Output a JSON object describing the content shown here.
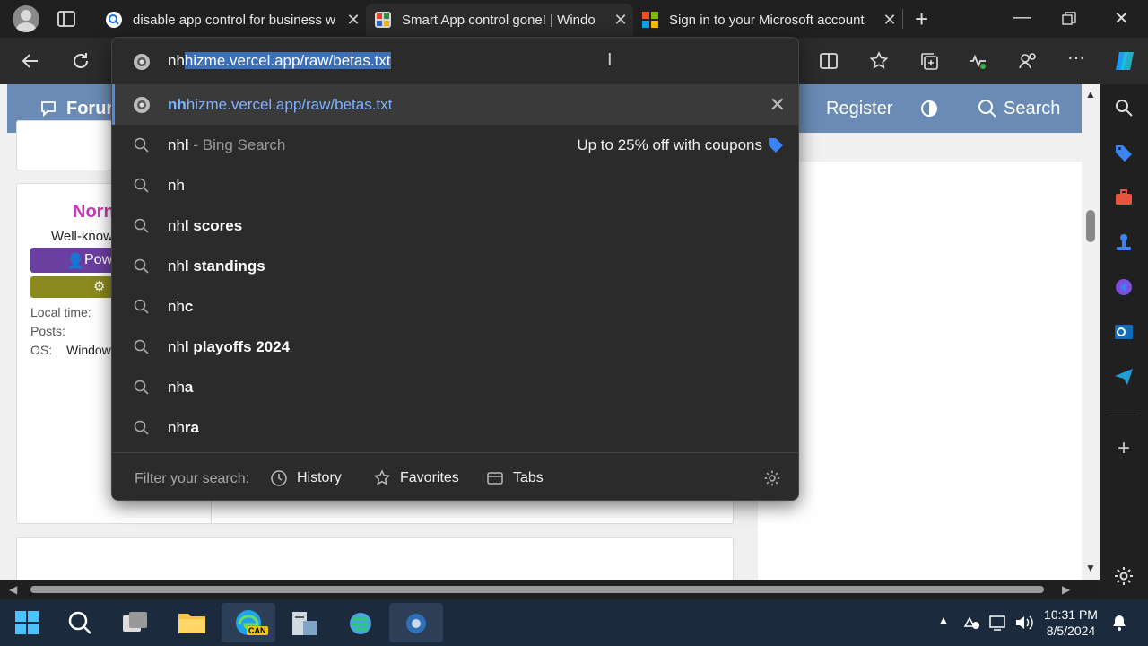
{
  "tabs": [
    {
      "title": "disable app control for business w",
      "active": false
    },
    {
      "title": "Smart App control gone! | Windo",
      "active": true
    },
    {
      "title": "Sign in to your Microsoft account",
      "active": false
    }
  ],
  "webpage": {
    "nav": {
      "forums": "Forur",
      "register": "Register",
      "search": "Search"
    },
    "profile": {
      "name": "Norn",
      "title": "Well-know",
      "badge": "Pow",
      "local_time_label": "Local time:",
      "posts_label": "Posts:",
      "os_label": "OS:",
      "os_value": "Window"
    }
  },
  "omnibox": {
    "typed": "nh",
    "autocomplete": "hizme.vercel.app/raw/betas.txt",
    "suggestions": [
      {
        "prefix": "nh",
        "rest": "hizme.vercel.app/raw/betas.txt",
        "kind": "url"
      },
      {
        "prefix": "nh",
        "rest": "l",
        "suffix": " - Bing Search",
        "promo": "Up to 25% off with coupons",
        "kind": "search"
      },
      {
        "prefix": "nh",
        "rest": "",
        "kind": "search"
      },
      {
        "prefix": "nh",
        "rest": "l scores",
        "kind": "search"
      },
      {
        "prefix": "nh",
        "rest": "l standings",
        "kind": "search"
      },
      {
        "prefix": "nh",
        "rest": "c",
        "kind": "search"
      },
      {
        "prefix": "nh",
        "rest": "l playoffs 2024",
        "kind": "search"
      },
      {
        "prefix": "nh",
        "rest": "a",
        "kind": "search"
      },
      {
        "prefix": "nh",
        "rest": "ra",
        "kind": "search"
      }
    ],
    "filter_label": "Filter your search:",
    "filters": {
      "history": "History",
      "favorites": "Favorites",
      "tabs": "Tabs"
    }
  },
  "taskbar": {
    "time": "10:31 PM",
    "date": "8/5/2024",
    "edge_badge": "CAN"
  },
  "colors": {
    "accent": "#3b6fb6",
    "forum_nav": "#6a8bb5",
    "profile_name": "#c23bb4",
    "badge_purple": "#6b3fa0",
    "badge_olive": "#8a8a1e"
  }
}
